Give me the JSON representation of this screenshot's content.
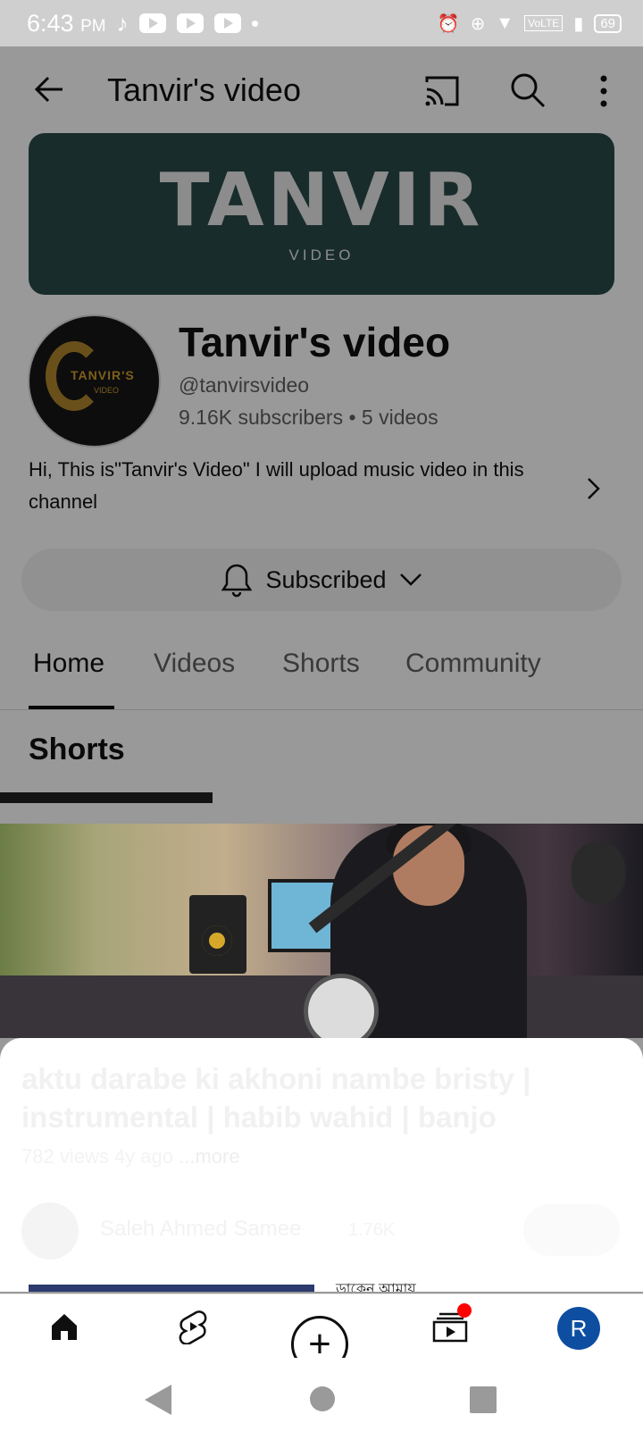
{
  "status_bar": {
    "time": "6:43",
    "ampm": "PM",
    "volte": "VoLTE",
    "battery": "69"
  },
  "header": {
    "title": "Tanvir's video"
  },
  "banner": {
    "logo_text": "TANVIR",
    "sub_text": "VIDEO"
  },
  "avatar": {
    "logo_text": "TANVIR'S",
    "sub_text": "VIDEO"
  },
  "channel": {
    "name": "Tanvir's video",
    "handle": "@tanvirsvideo",
    "meta": "9.16K subscribers • 5 videos",
    "description": "Hi, This is\"Tanvir's Video\" I will upload music video  in this  channel"
  },
  "subscribe": {
    "label": "Subscribed"
  },
  "tabs": [
    {
      "label": "Home"
    },
    {
      "label": "Videos"
    },
    {
      "label": "Shorts"
    },
    {
      "label": "Community"
    }
  ],
  "section": {
    "title": "Shorts"
  },
  "sheet": {
    "title": "aktu darabe ki akhoni nambe bristy | instrumental | habib wahid | banjo",
    "meta": "782 views  4y ago",
    "more": "...more",
    "channel": "Saleh Ahmed Samee",
    "subscriber_count": "1.76K",
    "peek_text": "ডাকেন আমায়"
  },
  "bottom_nav": {
    "account_initial": "R",
    "notification_color": "#ff0000"
  }
}
